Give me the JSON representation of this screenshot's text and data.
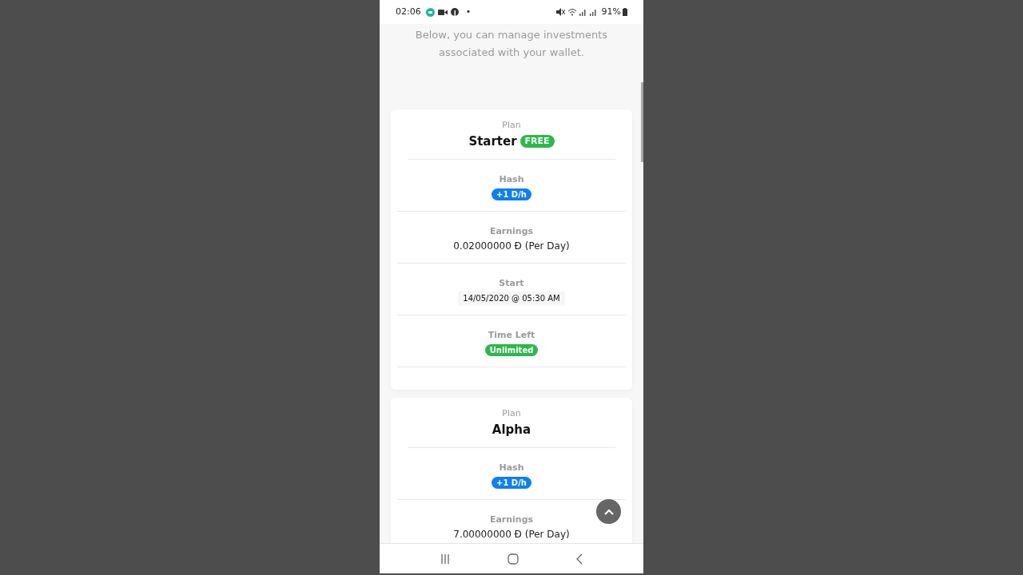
{
  "status_bar": {
    "time": "02:06",
    "dot": "•",
    "battery": "91%"
  },
  "intro": "Below, you can manage investments associated with your wallet.",
  "plans": [
    {
      "label": "Plan",
      "name": "Starter",
      "badge": "FREE",
      "fields": [
        {
          "label": "Hash",
          "kind": "badge",
          "value": "+1 D/h",
          "color": "#0d7ff2"
        },
        {
          "label": "Earnings",
          "kind": "text",
          "value": "0.02000000 Đ (Per Day)"
        },
        {
          "label": "Start",
          "kind": "chip",
          "value": "14/05/2020 @ 05:30 AM"
        },
        {
          "label": "Time Left",
          "kind": "badge",
          "value": "Unlimited",
          "color": "#2db84c"
        }
      ]
    },
    {
      "label": "Plan",
      "name": "Alpha",
      "fields": [
        {
          "label": "Hash",
          "kind": "badge",
          "value": "+1 D/h",
          "color": "#0d7ff2"
        },
        {
          "label": "Earnings",
          "kind": "text",
          "value": "7.00000000 Đ (Per Day)"
        }
      ]
    }
  ]
}
